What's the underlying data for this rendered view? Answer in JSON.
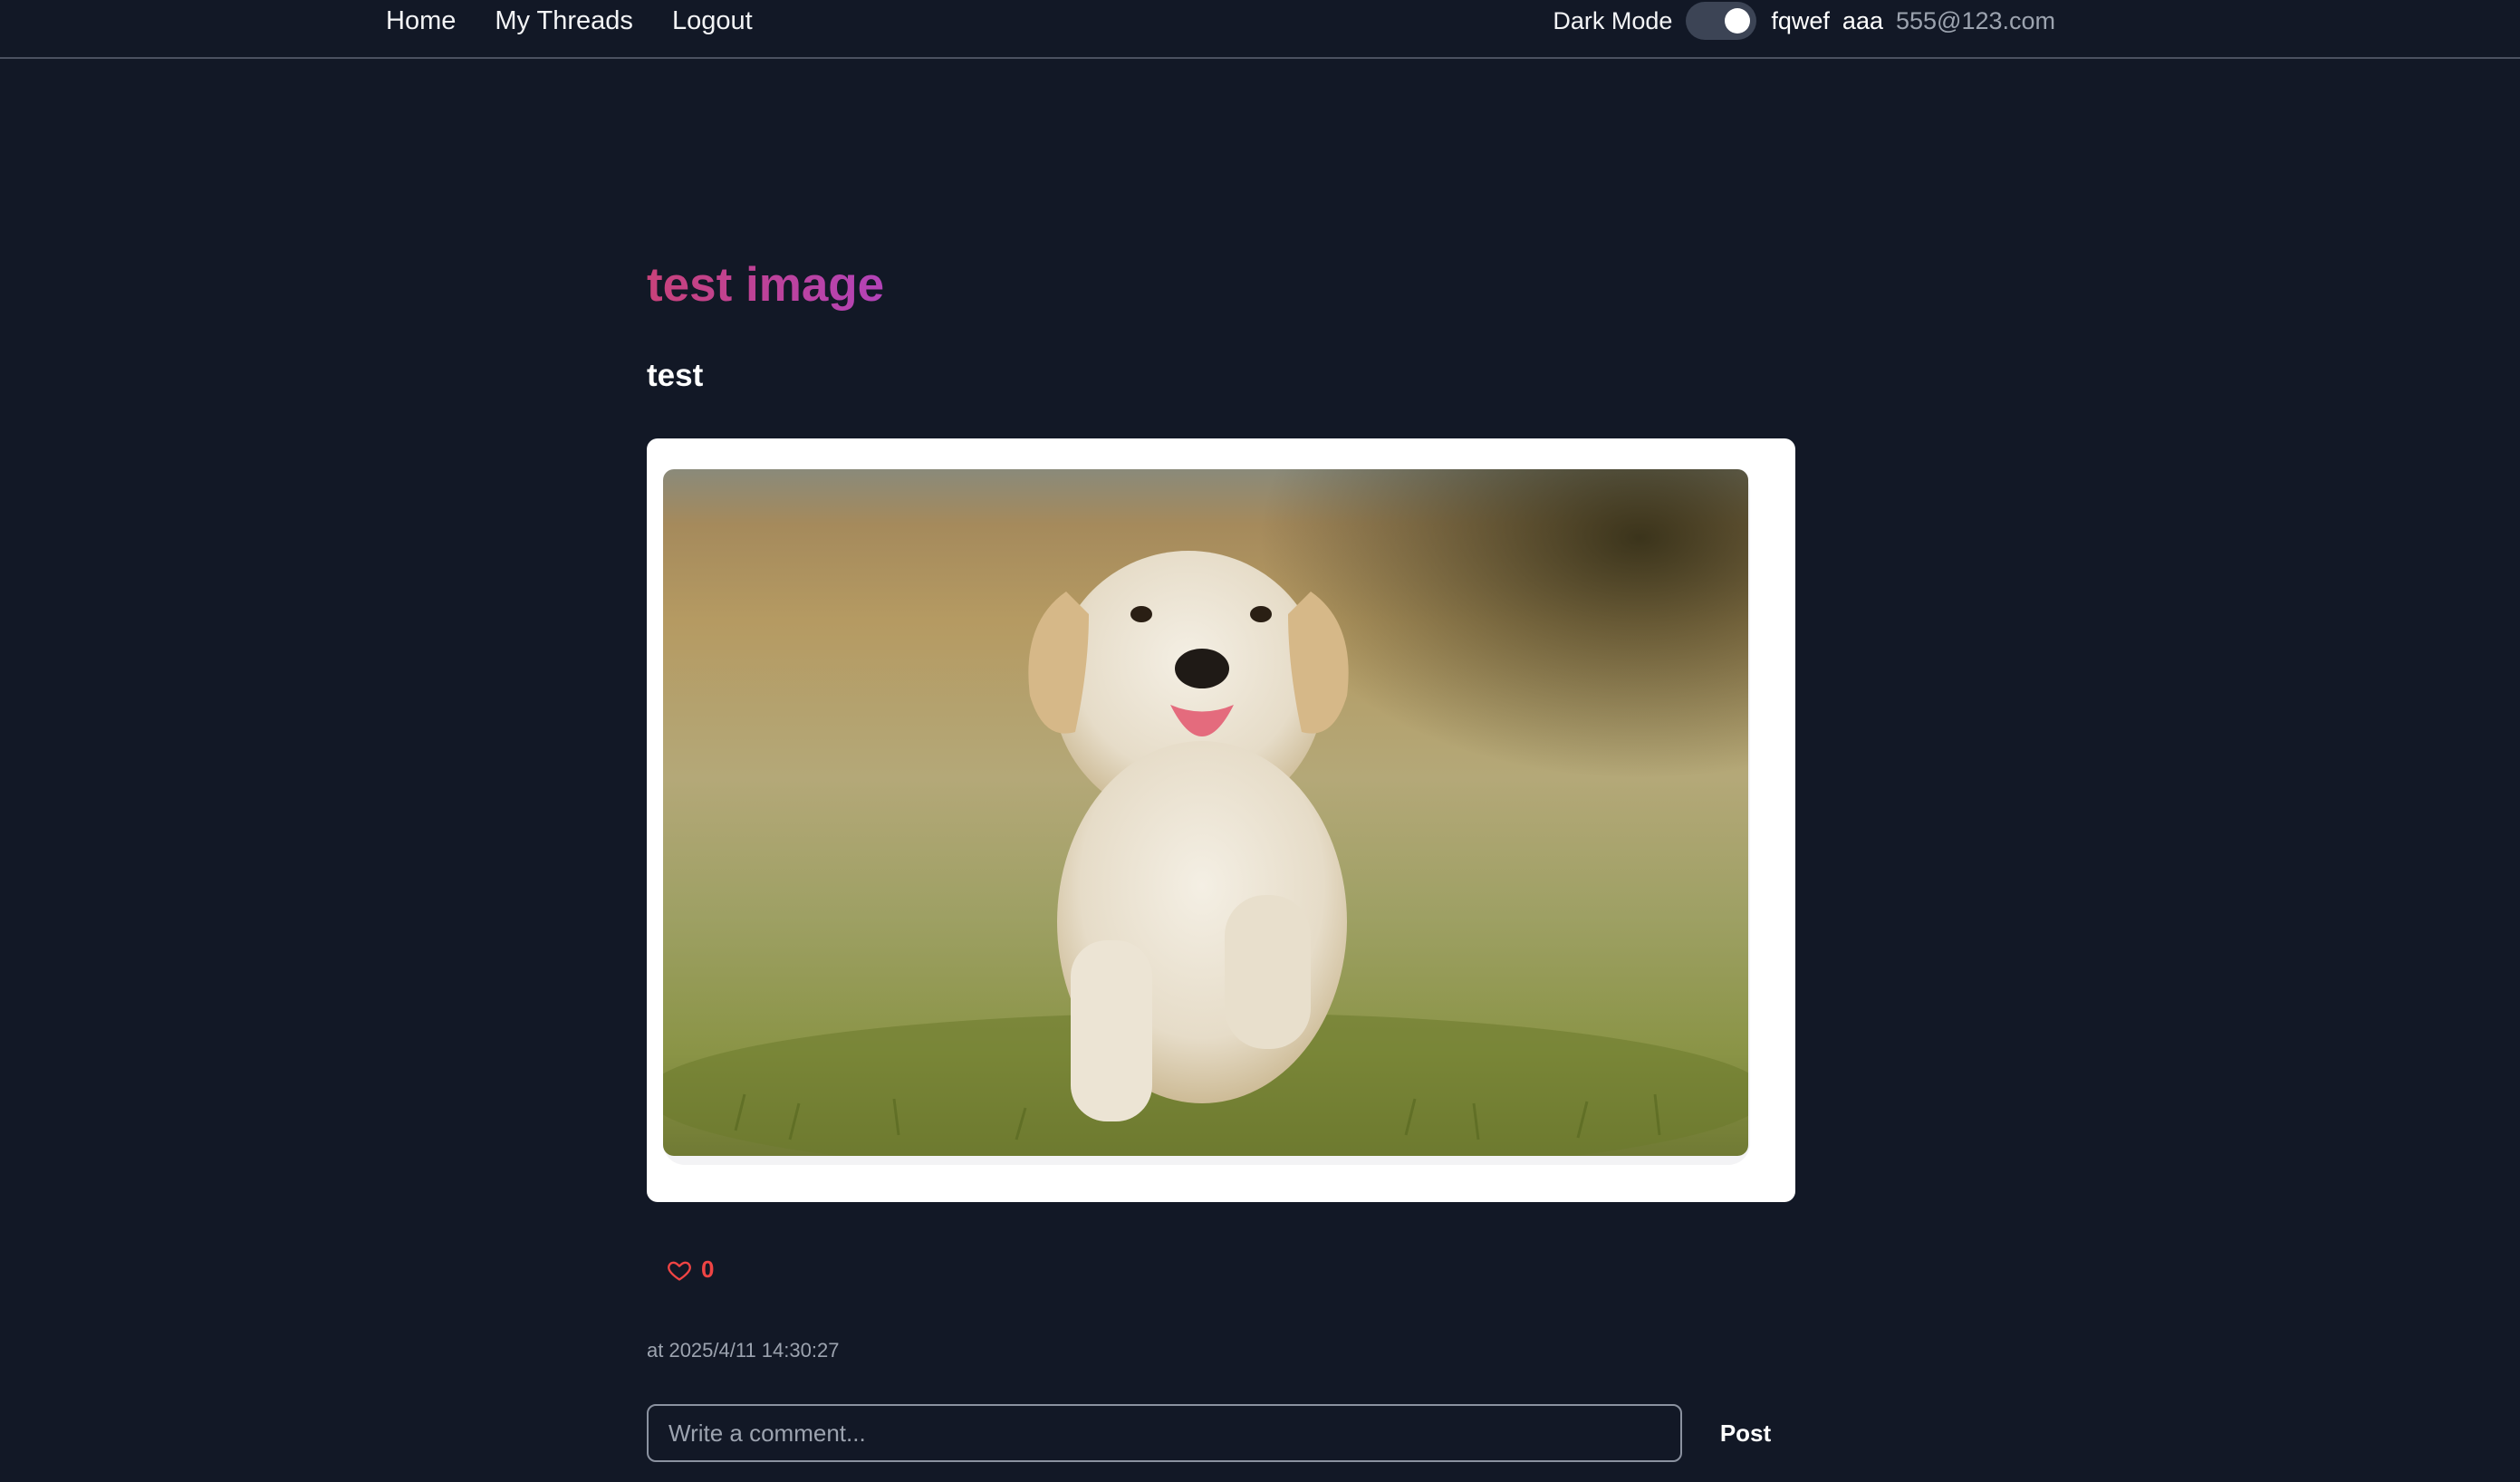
{
  "nav": {
    "links": [
      "Home",
      "My Threads",
      "Logout"
    ],
    "dark_mode_label": "Dark Mode",
    "dark_mode_on": true,
    "user_first": "fqwef",
    "user_last": "aaa",
    "user_email": "555@123.com"
  },
  "thread": {
    "title": "test image",
    "body": "test",
    "image_icon": "puppy-photo",
    "likes": "0",
    "timestamp": "at 2025/4/11 14:30:27"
  },
  "comment": {
    "placeholder": "Write a comment...",
    "value": "",
    "post_label": "Post"
  },
  "colors": {
    "background": "#121826",
    "title_gradient_start": "#c8427a",
    "title_gradient_end": "#b343b8",
    "like_red": "#ef4444",
    "muted_text": "#9ca3af"
  }
}
